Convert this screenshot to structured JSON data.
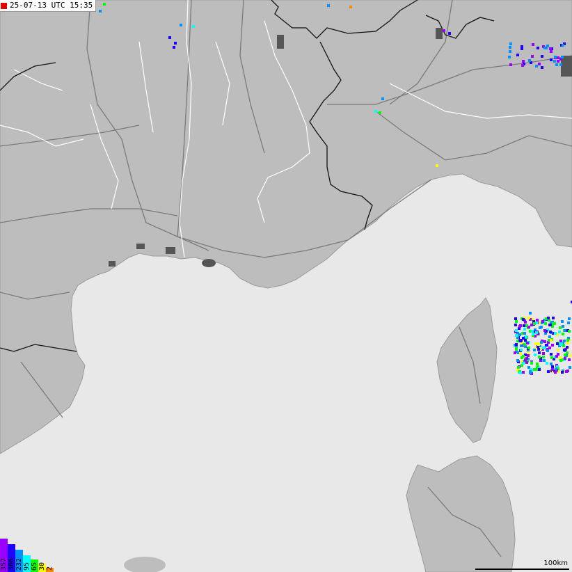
{
  "header": {
    "timestamp": "25-07-13 UTC 15:35",
    "live_color": "#e00000"
  },
  "legend": {
    "entries": [
      {
        "label": "357",
        "color": "#9a00ff"
      },
      {
        "label": "306",
        "color": "#2000ff"
      },
      {
        "label": "232",
        "color": "#0090ff"
      },
      {
        "label": "95",
        "color": "#00ffff"
      },
      {
        "label": "65",
        "color": "#00ff00"
      },
      {
        "label": "30",
        "color": "#ffff00"
      },
      {
        "label": "2",
        "color": "#ff8800"
      }
    ]
  },
  "scale": {
    "label": "100km"
  },
  "colors": {
    "sea": "#e8e8e8",
    "land": "#bdbdbd",
    "rivers": "#ffffff",
    "roads": "#7a7a7a",
    "borders": "#000000",
    "urban": "#555555"
  }
}
